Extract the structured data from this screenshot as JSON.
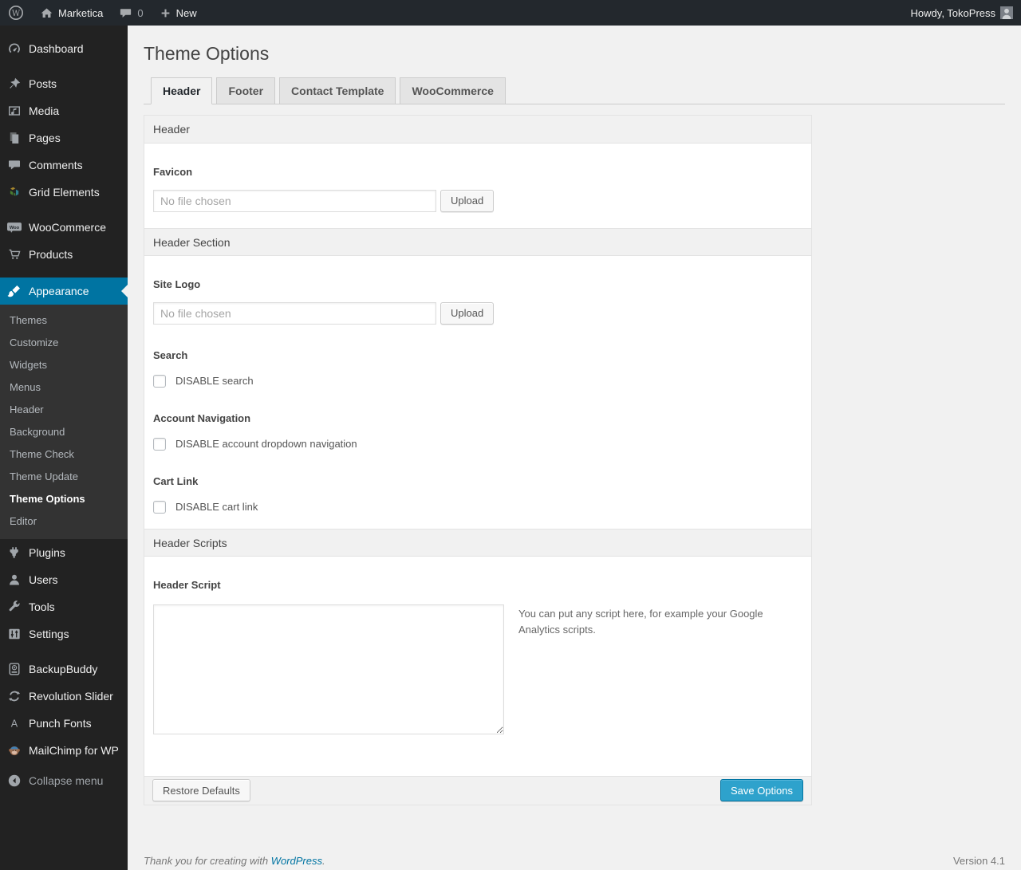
{
  "colors": {
    "accent_blue": "#0074a2",
    "primary_button": "#2ea2cc",
    "admin_bar_bg": "#23282d",
    "menu_bg": "#222222",
    "submenu_bg": "#333333",
    "content_bg": "#f1f1f1"
  },
  "admin_bar": {
    "wordpress_logo_icon": "wordpress-logo-icon",
    "home_icon": "home-icon",
    "site_name": "Marketica",
    "comment_bubble_icon": "comment-bubble-icon",
    "comment_count": "0",
    "plus_icon": "plus-icon",
    "new_label": "New",
    "greeting": "Howdy, TokoPress",
    "avatar_icon": "avatar"
  },
  "sidebar": {
    "top_items": [
      {
        "label": "Dashboard",
        "icon": "dashboard-icon"
      },
      {
        "label": "Posts",
        "icon": "pushpin-icon"
      },
      {
        "label": "Media",
        "icon": "media-icon"
      },
      {
        "label": "Pages",
        "icon": "pages-icon"
      },
      {
        "label": "Comments",
        "icon": "comments-icon"
      },
      {
        "label": "Grid Elements",
        "icon": "grid-elements-icon"
      },
      {
        "label": "WooCommerce",
        "icon": "woocommerce-icon"
      },
      {
        "label": "Products",
        "icon": "cart-icon"
      }
    ],
    "appearance": {
      "label": "Appearance",
      "icon": "paintbrush-icon",
      "current_item": "Theme Options",
      "submenu": [
        "Themes",
        "Customize",
        "Widgets",
        "Menus",
        "Header",
        "Background",
        "Theme Check",
        "Theme Update",
        "Theme Options",
        "Editor"
      ]
    },
    "bottom_items": [
      {
        "label": "Plugins",
        "icon": "plug-icon"
      },
      {
        "label": "Users",
        "icon": "user-icon"
      },
      {
        "label": "Tools",
        "icon": "wrench-icon"
      },
      {
        "label": "Settings",
        "icon": "sliders-icon"
      },
      {
        "label": "BackupBuddy",
        "icon": "backup-drive-icon"
      },
      {
        "label": "Revolution Slider",
        "icon": "circular-arrows-icon"
      },
      {
        "label": "Punch Fonts",
        "icon": "letter-a-icon"
      },
      {
        "label": "MailChimp for WP",
        "icon": "monkey-icon"
      }
    ],
    "collapse_label": "Collapse menu"
  },
  "main": {
    "page_title": "Theme Options",
    "tabs": [
      {
        "label": "Header",
        "active": true
      },
      {
        "label": "Footer",
        "active": false
      },
      {
        "label": "Contact Template",
        "active": false
      },
      {
        "label": "WooCommerce",
        "active": false
      }
    ],
    "panel": {
      "section_header": "Header",
      "favicon": {
        "label": "Favicon",
        "placeholder": "No file chosen",
        "button": "Upload"
      },
      "section_header_section": "Header Section",
      "site_logo": {
        "label": "Site Logo",
        "placeholder": "No file chosen",
        "button": "Upload"
      },
      "search": {
        "label": "Search",
        "checkbox_label": "DISABLE search",
        "checked": false
      },
      "account_nav": {
        "label": "Account Navigation",
        "checkbox_label": "DISABLE account dropdown navigation",
        "checked": false
      },
      "cart_link": {
        "label": "Cart Link",
        "checkbox_label": "DISABLE cart link",
        "checked": false
      },
      "section_scripts": "Header Scripts",
      "header_script": {
        "label": "Header Script",
        "value": "",
        "hint": "You can put any script here, for example your Google Analytics scripts."
      },
      "restore_button": "Restore Defaults",
      "save_button": "Save Options"
    }
  },
  "footer": {
    "thanks_prefix": "Thank you for creating with ",
    "wordpress_link": "WordPress",
    "thanks_suffix": ".",
    "version": "Version 4.1"
  }
}
